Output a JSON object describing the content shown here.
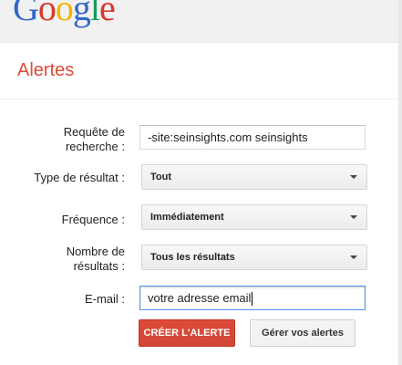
{
  "header": {
    "logo_letters": [
      {
        "ch": "G",
        "color": "#3366cc"
      },
      {
        "ch": "o",
        "color": "#d8382e"
      },
      {
        "ch": "o",
        "color": "#f4b400"
      },
      {
        "ch": "g",
        "color": "#3366cc"
      },
      {
        "ch": "l",
        "color": "#0f9d58"
      },
      {
        "ch": "e",
        "color": "#d8382e"
      }
    ]
  },
  "page": {
    "title": "Alertes"
  },
  "form": {
    "query_label_line1": "Requête de",
    "query_label_line2": "recherche :",
    "query_value": "-site:seinsights.com seinsights",
    "type_label": "Type de résultat :",
    "type_value": "Tout",
    "frequency_label": "Fréquence :",
    "frequency_value": "Immédiatement",
    "count_label_line1": "Nombre de",
    "count_label_line2": "résultats :",
    "count_value": "Tous les résultats",
    "email_label": "E-mail :",
    "email_value": "votre adresse email"
  },
  "actions": {
    "create_label": "CRÉER L'ALERTE",
    "manage_label": "Gérer vos alertes"
  },
  "colors": {
    "accent_red": "#dd4b39",
    "focus_blue": "#4d90fe"
  }
}
